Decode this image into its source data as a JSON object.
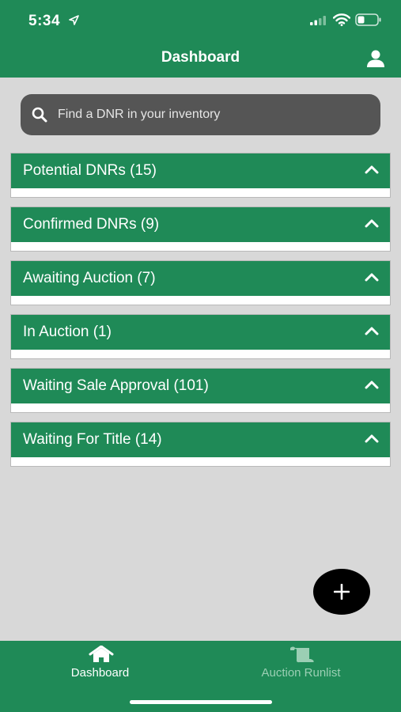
{
  "status_bar": {
    "time": "5:34"
  },
  "header": {
    "title": "Dashboard"
  },
  "search": {
    "placeholder": "Find a DNR in your inventory"
  },
  "sections": [
    {
      "label": "Potential DNRs (15)"
    },
    {
      "label": "Confirmed DNRs (9)"
    },
    {
      "label": "Awaiting Auction (7)"
    },
    {
      "label": "In Auction (1)"
    },
    {
      "label": "Waiting Sale Approval (101)"
    },
    {
      "label": "Waiting For Title (14)"
    }
  ],
  "tabbar": {
    "dashboard_label": "Dashboard",
    "runlist_label": "Auction Runlist"
  },
  "colors": {
    "primary": "#1f8a57",
    "background": "#d8d8d8",
    "search_bg": "#555555",
    "fab": "#000000",
    "inactive_tab": "#9bcfb4"
  },
  "icons": {
    "location": "location-arrow-icon",
    "signal": "cellular-signal-icon",
    "wifi": "wifi-icon",
    "battery": "battery-icon",
    "profile": "user-icon",
    "search": "search-icon",
    "chevron": "chevron-up-icon",
    "add": "plus-icon",
    "home": "home-icon",
    "runlist": "scroll-icon"
  }
}
